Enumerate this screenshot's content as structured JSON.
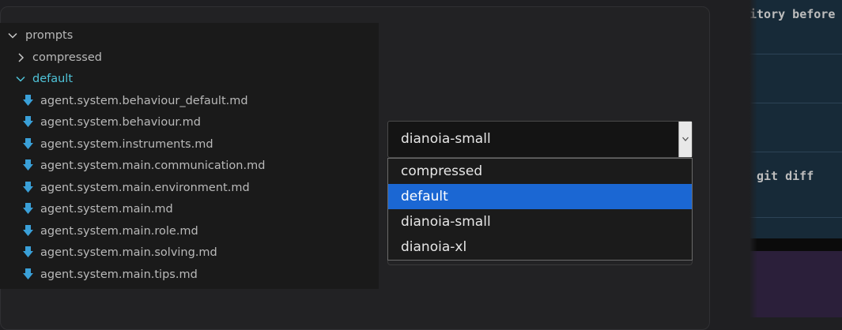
{
  "tree": {
    "root_label": "prompts",
    "compressed_label": "compressed",
    "default_label": "default",
    "files": [
      "agent.system.behaviour_default.md",
      "agent.system.behaviour.md",
      "agent.system.instruments.md",
      "agent.system.main.communication.md",
      "agent.system.main.environment.md",
      "agent.system.main.md",
      "agent.system.main.role.md",
      "agent.system.main.solving.md",
      "agent.system.main.tips.md"
    ]
  },
  "select": {
    "value": "dianoia-small",
    "options": [
      "compressed",
      "default",
      "dianoia-small",
      "dianoia-xl"
    ],
    "highlighted": "default"
  },
  "background_text": {
    "line1": "itory before",
    "line2": "git diff"
  },
  "colors": {
    "highlight": "#1b67d3",
    "folder_open": "#4fc3d8",
    "file_icon": "#3aa0d8"
  },
  "icons": [
    "chevron-down-icon",
    "chevron-right-icon",
    "file-download-icon",
    "dropdown-arrow-icon"
  ]
}
